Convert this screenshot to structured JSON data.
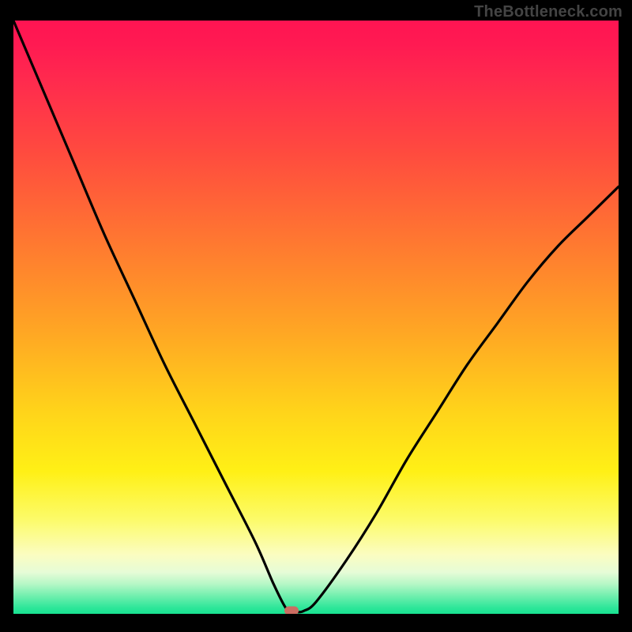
{
  "watermark": "TheBottleneck.com",
  "colors": {
    "frame": "#000000",
    "curve": "#000000",
    "marker": "#cb6d62",
    "gradient_top": "#ff1452",
    "gradient_bottom": "#18e292"
  },
  "chart_data": {
    "type": "line",
    "title": "",
    "xlabel": "",
    "ylabel": "",
    "xlim": [
      0,
      100
    ],
    "ylim": [
      0,
      100
    ],
    "grid": false,
    "background": "rainbow-vertical-gradient (red top → green bottom)",
    "series": [
      {
        "name": "bottleneck-curve",
        "x": [
          0,
          5,
          10,
          15,
          20,
          25,
          30,
          35,
          40,
          43,
          45,
          46,
          47,
          48,
          50,
          55,
          60,
          65,
          70,
          75,
          80,
          85,
          90,
          95,
          100
        ],
        "values": [
          100,
          88,
          76,
          64,
          53,
          42,
          32,
          22,
          12,
          5,
          1,
          0.5,
          0.3,
          0.5,
          2,
          9,
          17,
          26,
          34,
          42,
          49,
          56,
          62,
          67,
          72
        ]
      }
    ],
    "annotations": [
      {
        "name": "minimum-point",
        "x": 46,
        "y": 0.5,
        "marker": "rounded-rect"
      }
    ]
  }
}
